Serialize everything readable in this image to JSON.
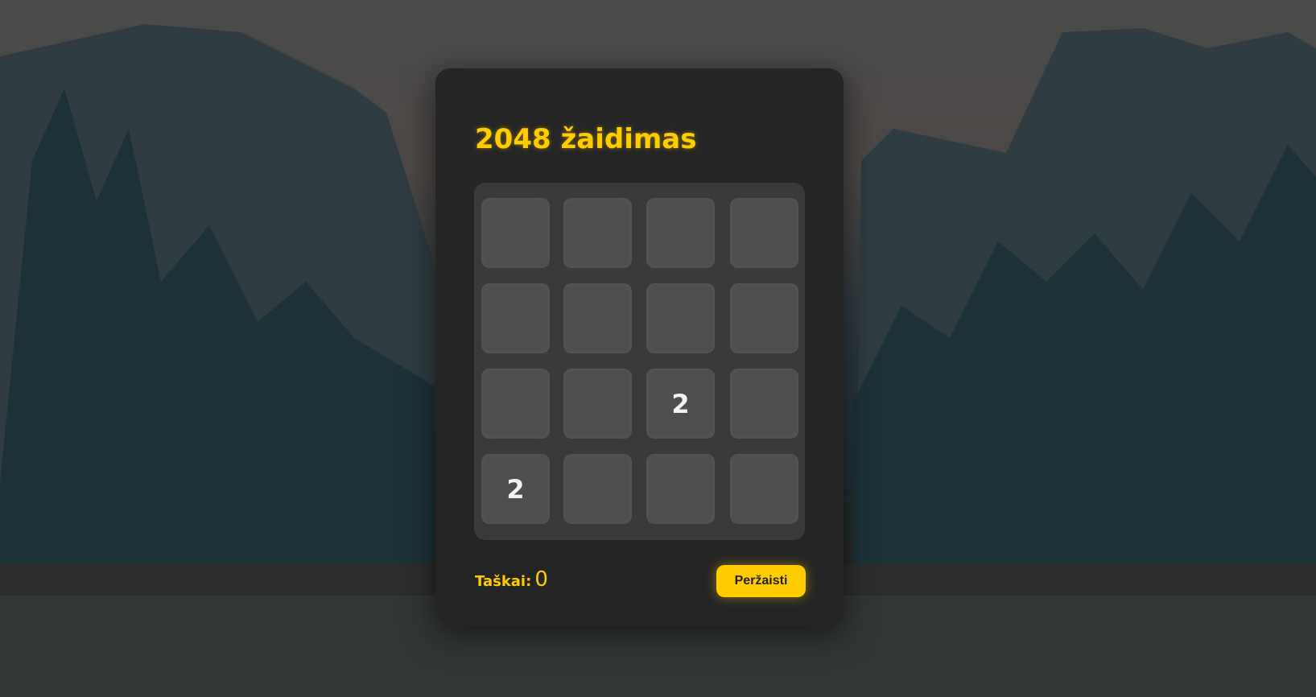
{
  "game": {
    "title": "2048 žaidimas",
    "grid": [
      [
        "",
        "",
        "",
        ""
      ],
      [
        "",
        "",
        "",
        ""
      ],
      [
        "",
        "",
        "2",
        ""
      ],
      [
        "2",
        "",
        "",
        ""
      ]
    ],
    "score_label": "Taškai:",
    "score_value": "0",
    "restart_label": "Peržaisti"
  },
  "colors": {
    "accent": "#ffcc00",
    "card": "#242424",
    "board": "#3a3a3a",
    "tile": "#4e4e4e"
  }
}
